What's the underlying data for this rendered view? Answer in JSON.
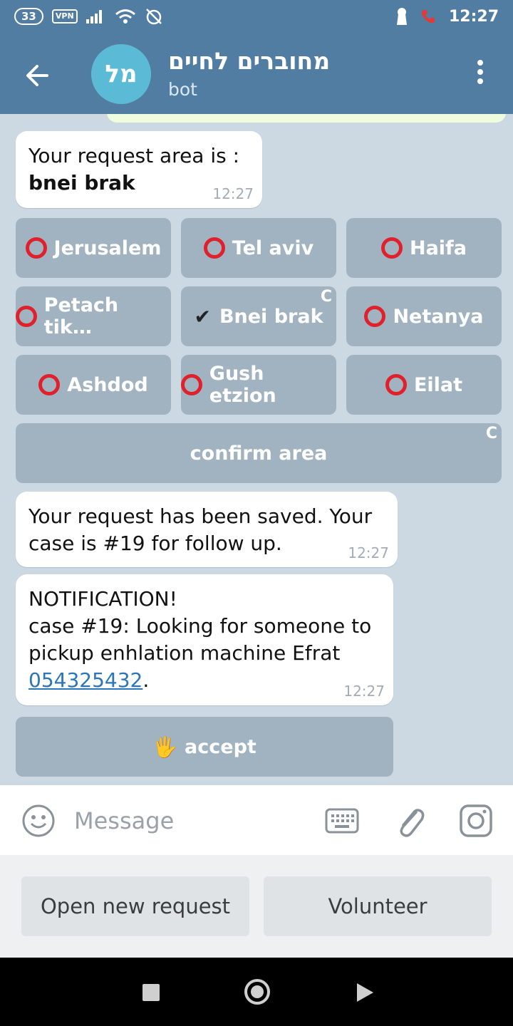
{
  "status_bar": {
    "battery": "33",
    "vpn": "VPN",
    "time": "12:27",
    "icons": [
      "signal-icon",
      "wifi-icon",
      "alarm-off-icon",
      "keyhole-icon",
      "call-icon"
    ]
  },
  "header": {
    "avatar_initials": "מל",
    "title": "מחוברים לחיים",
    "subtitle": "bot",
    "icons": [
      "back-arrow-icon",
      "more-vert-icon"
    ]
  },
  "messages": [
    {
      "line1": "Your request area is :",
      "line2": "bnei brak",
      "time": "12:27"
    },
    {
      "text": "Your request has been saved. Your case is #19 for follow up.",
      "time": "12:27"
    },
    {
      "line1": "NOTIFICATION!",
      "line2": "case #19: Looking for someone to pickup   enhlation machine  Efrat",
      "phone": "054325432",
      "after_phone": ".",
      "time": "12:27"
    }
  ],
  "area_keyboard": {
    "areas": [
      {
        "label": "Jerusalem",
        "selected": false
      },
      {
        "label": "Tel aviv",
        "selected": false
      },
      {
        "label": "Haifa",
        "selected": false
      },
      {
        "label": "Petach tik…",
        "selected": false
      },
      {
        "label": "Bnei brak",
        "selected": true,
        "check_glyph": "✔"
      },
      {
        "label": "Netanya",
        "selected": false
      },
      {
        "label": "Ashdod",
        "selected": false
      },
      {
        "label": "Gush etzion",
        "selected": false
      },
      {
        "label": "Eilat",
        "selected": false
      }
    ],
    "confirm_label": "confirm area",
    "loading_glyph": "C"
  },
  "accept_button": {
    "emoji": "🖐",
    "label": "accept"
  },
  "input_bar": {
    "placeholder": "Message",
    "icons": [
      "emoji-icon",
      "keyboard-icon",
      "attach-icon",
      "camera-icon"
    ]
  },
  "reply_keyboard": {
    "left_label": "Open new request",
    "right_label": "Volunteer"
  },
  "colors": {
    "header": "#527da3",
    "chat_bg": "#cdd9e2",
    "link": "#2b76b9",
    "unselected_ring": "#e0202a"
  }
}
